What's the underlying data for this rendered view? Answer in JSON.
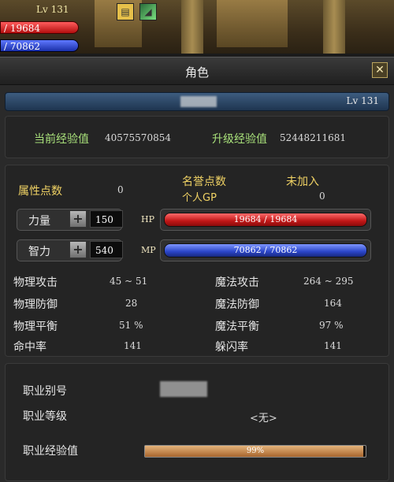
{
  "hud": {
    "level": "Lv 131",
    "hp": "/ 19684",
    "mp": "/ 70862"
  },
  "window": {
    "title": "角色",
    "close_glyph": "✕",
    "level": "Lv 131"
  },
  "experience": {
    "current_label": "当前经验值",
    "current_value": "40575570854",
    "next_label": "升级经验值",
    "next_value": "52448211681"
  },
  "attributes": {
    "points_label": "属性点数",
    "points_value": "0",
    "honor_label": "名誉点数",
    "personal_gp_label": "个人GP",
    "personal_gp_value": "0",
    "not_joined": "未加入",
    "strength_label": "力量",
    "strength_value": "150",
    "intellect_label": "智力",
    "intellect_value": "540",
    "hp_tag": "HP",
    "mp_tag": "MP",
    "hp_text": "19684 / 19684",
    "mp_text": "70862 / 70862",
    "hp_fraction": 1.0,
    "mp_fraction": 1.0
  },
  "stats": {
    "left": [
      {
        "label": "物理攻击",
        "value": "45 ~ 51"
      },
      {
        "label": "物理防御",
        "value": "28"
      },
      {
        "label": "物理平衡",
        "value": "51 %"
      },
      {
        "label": "命中率",
        "value": "141"
      }
    ],
    "right": [
      {
        "label": "魔法攻击",
        "value": "264 ~ 295"
      },
      {
        "label": "魔法防御",
        "value": "164"
      },
      {
        "label": "魔法平衡",
        "value": "97 %"
      },
      {
        "label": "躲闪率",
        "value": "141"
      }
    ]
  },
  "job": {
    "alias_label": "职业别号",
    "level_label": "职业等级",
    "level_value": "<无>",
    "exp_label": "职业经验值",
    "exp_text": "99%",
    "exp_fraction": 0.99
  },
  "colors": {
    "hp": "#c01616",
    "mp": "#2a45c8",
    "gold_label": "#f0d264",
    "green_value": "#a8e07a"
  }
}
